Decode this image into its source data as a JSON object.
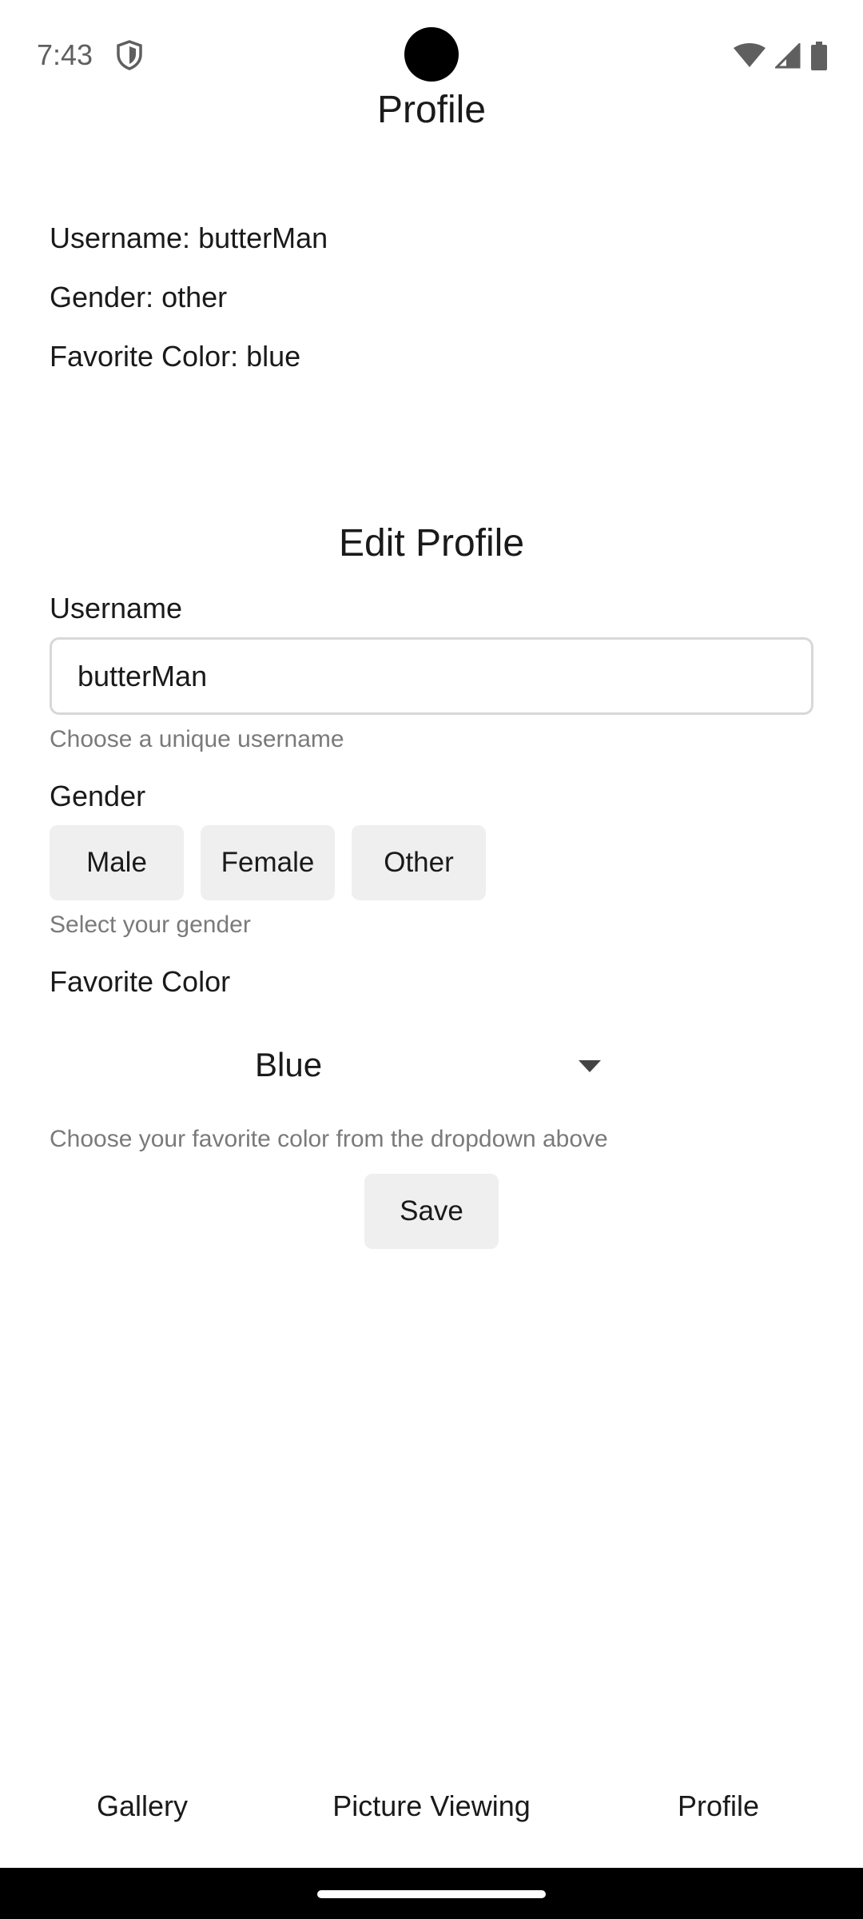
{
  "status_bar": {
    "time": "7:43",
    "icons": [
      "shield-icon",
      "wifi-icon",
      "signal-icon",
      "battery-icon"
    ]
  },
  "profile": {
    "title": "Profile",
    "username_line": "Username: butterMan",
    "gender_line": "Gender: other",
    "color_line": "Favorite Color: blue"
  },
  "edit": {
    "title": "Edit Profile",
    "username_label": "Username",
    "username_value": "butterMan",
    "username_helper": "Choose a unique username",
    "gender_label": "Gender",
    "gender_options": [
      "Male",
      "Female",
      "Other"
    ],
    "gender_helper": "Select your gender",
    "color_label": "Favorite Color",
    "color_value": "Blue",
    "color_helper": "Choose your favorite color from the dropdown above",
    "save_label": "Save"
  },
  "nav": {
    "items": [
      "Gallery",
      "Picture Viewing",
      "Profile"
    ]
  },
  "colors": {
    "chip_bg": "#efefef",
    "helper_text": "#7a7a7a",
    "input_border": "#d8d8d8"
  }
}
